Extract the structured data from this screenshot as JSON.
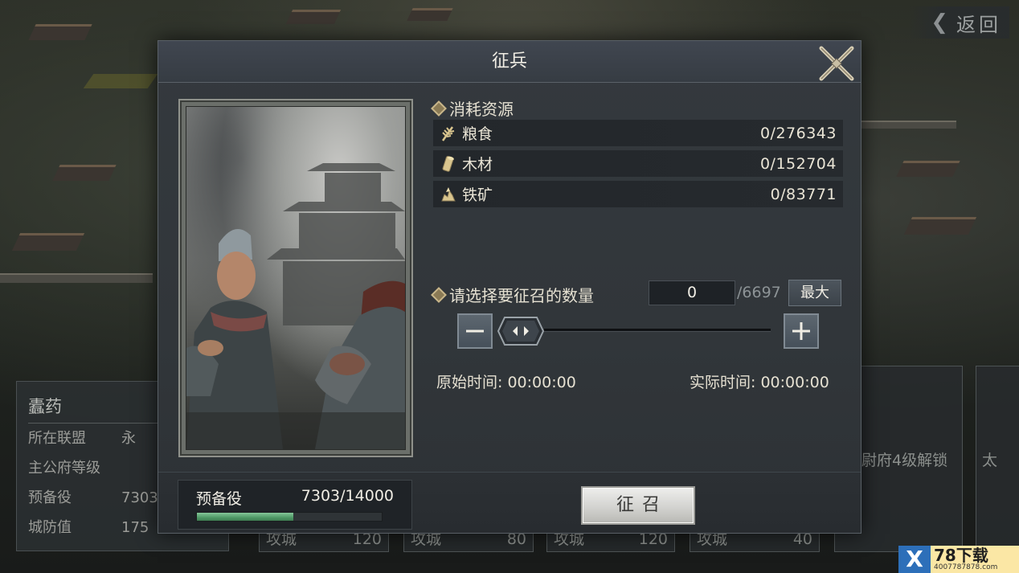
{
  "background": {
    "back_label": "返回",
    "info_panel": {
      "title": "蠹药",
      "rows": [
        {
          "key": "所在联盟",
          "value": "永"
        },
        {
          "key": "主公府等级",
          "value": ""
        },
        {
          "key": "预备役",
          "value": "7303"
        },
        {
          "key": "城防值",
          "value": "175"
        }
      ]
    },
    "cards": [
      {
        "label": "攻城",
        "value": "120"
      },
      {
        "label": "攻城",
        "value": "80"
      },
      {
        "label": "攻城",
        "value": "120"
      },
      {
        "label": "攻城",
        "value": "40"
      }
    ],
    "unlock_text": "尉府4级解锁",
    "side_text": "太"
  },
  "dialog": {
    "title": "征兵",
    "resources_title": "消耗资源",
    "resources": [
      {
        "icon": "grain-icon",
        "name": "粮食",
        "value": "0/276343"
      },
      {
        "icon": "wood-icon",
        "name": "木材",
        "value": "0/152704"
      },
      {
        "icon": "iron-ore-icon",
        "name": "铁矿",
        "value": "0/83771"
      }
    ],
    "quantity_title": "请选择要征召的数量",
    "quantity_value": "0",
    "quantity_max_text": "/6697",
    "max_button": "最大",
    "slider_value": 0,
    "original_time_label": "原始时间:",
    "original_time_value": "00:00:00",
    "actual_time_label": "实际时间:",
    "actual_time_value": "00:00:00",
    "reserve_label": "预备役",
    "reserve_value": "7303/14000",
    "reserve_fraction": 0.52,
    "recruit_button": "征召"
  },
  "watermark": {
    "brand": "78下载",
    "url": "4007787878.com"
  },
  "colors": {
    "accent_gold": "#c9b68a",
    "progress_green": "#4f9a67",
    "panel_bg": "#34393e"
  }
}
